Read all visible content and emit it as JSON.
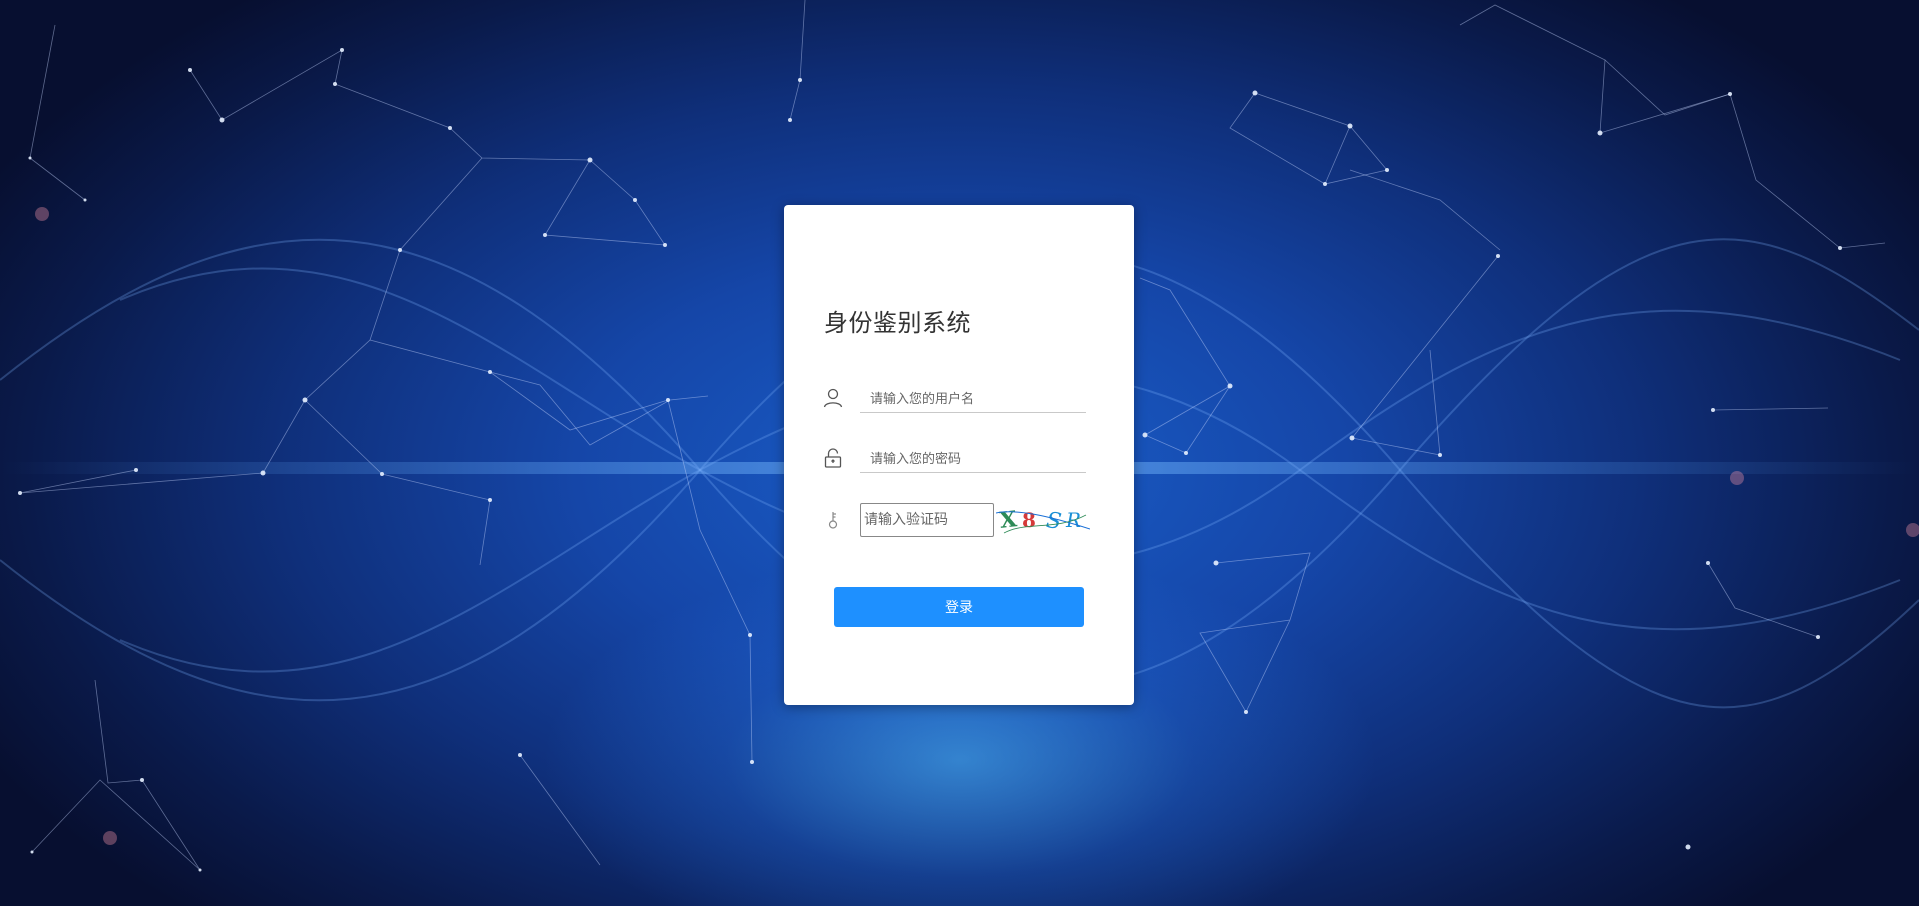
{
  "login": {
    "title": "身份鉴别系统",
    "username_placeholder": "请输入您的用户名",
    "password_placeholder": "请输入您的密码",
    "captcha_placeholder": "请输入验证码",
    "captcha_text": "X8SR",
    "login_label": "登录"
  },
  "icons": {
    "username": "user-icon",
    "password": "unlock-icon",
    "captcha": "key-icon"
  },
  "colors": {
    "accent": "#1e90ff",
    "background_dark": "#0a1a4a",
    "background_mid": "#1a5ec9"
  }
}
